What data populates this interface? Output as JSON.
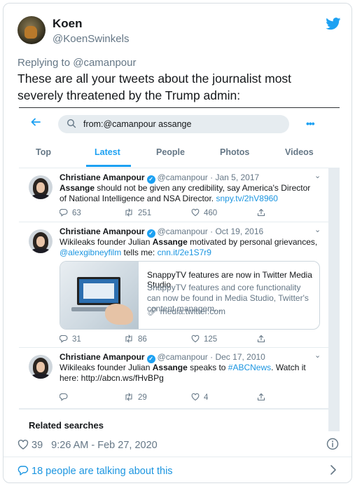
{
  "author": {
    "name": "Koen",
    "handle": "@KoenSwinkels"
  },
  "reply": {
    "prefix": "Replying to ",
    "mention": "@camanpour"
  },
  "tweet": {
    "text": "These are all your tweets about the journalist most severely threatened by the Trump admin:"
  },
  "embedded": {
    "search": {
      "query": "from:@camanpour assange"
    },
    "tabs": [
      "Top",
      "Latest",
      "People",
      "Photos",
      "Videos"
    ],
    "active_tab": "Latest",
    "results": [
      {
        "name": "Christiane Amanpour",
        "handle": "@camanpour",
        "date": "Jan 5, 2017",
        "body_parts": [
          "Assange",
          " should not be given any credibility, say America's Director of National Intelligence and NSA Director. ",
          "snpy.tv/2hV8960"
        ],
        "replies": "63",
        "retweets": "251",
        "likes": "460"
      },
      {
        "name": "Christiane Amanpour",
        "handle": "@camanpour",
        "date": "Oct 19, 2016",
        "body_parts": [
          "Wikileaks founder Julian ",
          "Assange",
          " motivated by personal grievances, ",
          "@alexgibneyfilm",
          " tells me: ",
          "cnn.it/2e1S7r9"
        ],
        "card": {
          "title": "SnappyTV features are now in Twitter Media Studio",
          "description": "SnappyTV features and core functionality can now be found in Media Studio, Twitter's content managem...",
          "domain": "media.twitter.com"
        },
        "replies": "31",
        "retweets": "86",
        "likes": "125"
      },
      {
        "name": "Christiane Amanpour",
        "handle": "@camanpour",
        "date": "Dec 17, 2010",
        "body_parts": [
          "Wikileaks founder Julian ",
          "Assange",
          " speaks to ",
          "#ABCNews",
          ". Watch it here: http://abcn.ws/fHvBPg"
        ],
        "replies": "",
        "retweets": "29",
        "likes": "4"
      }
    ],
    "related_title": "Related searches"
  },
  "footer": {
    "likes": "39",
    "timestamp": "9:26 AM - Feb 27, 2020",
    "talking": "18 people are talking about this"
  },
  "colors": {
    "twitter_blue": "#1da1f2",
    "link": "#1b95e0",
    "muted": "#657786",
    "text": "#14171a"
  }
}
